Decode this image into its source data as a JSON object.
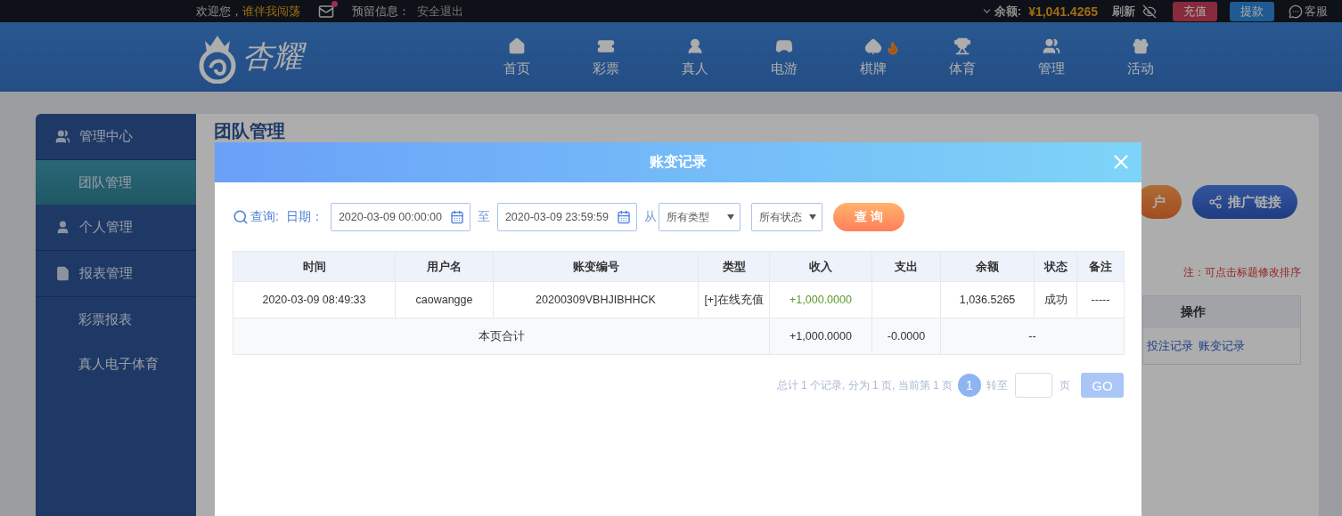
{
  "top_bar": {
    "welcome": "欢迎您，",
    "username": "谁伴我闯荡",
    "mail_unread": true,
    "reserved_label": "预留信息：",
    "logout": "安全退出",
    "balance_label": "余额:",
    "balance": "¥1,041.4265",
    "refresh": "刷新",
    "deposit": "充值",
    "withdraw": "提款",
    "service": "客服"
  },
  "header": {
    "logo": "杏耀",
    "nav": [
      {
        "label": "首页",
        "kind": "home",
        "hot": false
      },
      {
        "label": "彩票",
        "kind": "ticket",
        "hot": false
      },
      {
        "label": "真人",
        "kind": "live",
        "hot": false
      },
      {
        "label": "电游",
        "kind": "game",
        "hot": false
      },
      {
        "label": "棋牌",
        "kind": "cards",
        "hot": true
      },
      {
        "label": "体育",
        "kind": "sport",
        "hot": false
      },
      {
        "label": "管理",
        "kind": "manage",
        "hot": false
      },
      {
        "label": "活动",
        "kind": "gift",
        "hot": false
      }
    ]
  },
  "sidebar": {
    "items": [
      {
        "label": "管理中心",
        "kind": "team",
        "selected": false,
        "children": [
          {
            "label": "团队管理",
            "selected": true
          }
        ]
      },
      {
        "label": "个人管理",
        "kind": "person",
        "selected": false
      },
      {
        "label": "报表管理",
        "kind": "report",
        "selected": false,
        "children": [
          {
            "label": "彩票报表",
            "selected": false
          },
          {
            "label": "真人电子体育",
            "selected": false
          }
        ]
      }
    ]
  },
  "page": {
    "title": "团队管理",
    "buttons": [
      "户",
      "推广链接"
    ],
    "note": "注：可点击标题修改排序",
    "column_header": "操作",
    "links": [
      "投注记录",
      "账变记录"
    ]
  },
  "dialog": {
    "title": "账变记录",
    "query": {
      "label": "查询:",
      "date_label": "日期：",
      "start": "2020-03-09 00:00:00",
      "to": "至",
      "end": "2020-03-09 23:59:59",
      "from": "从",
      "type": "所有类型",
      "status": "所有状态",
      "button": "查 询"
    },
    "table": {
      "columns": [
        "时间",
        "用户名",
        "账变编号",
        "类型",
        "收入",
        "支出",
        "余额",
        "状态",
        "备注"
      ],
      "rows": [
        [
          "2020-03-09 08:49:33",
          "caowangge",
          "20200309VBHJIBHHCK",
          "[+]在线充值",
          "+1,000.0000",
          "",
          "1,036.5265",
          "成功",
          "-----"
        ]
      ],
      "total": {
        "label": "本页合计",
        "income": "+1,000.0000",
        "expense": "-0.0000",
        "rest": "--"
      }
    },
    "pagination": {
      "summary": "总计 1 个记录, 分为 1 页, 当前第 1 页",
      "pages": [
        {
          "label": "1",
          "selected": true
        }
      ],
      "goto": "转至",
      "page_unit": "页",
      "go": "GO"
    }
  }
}
